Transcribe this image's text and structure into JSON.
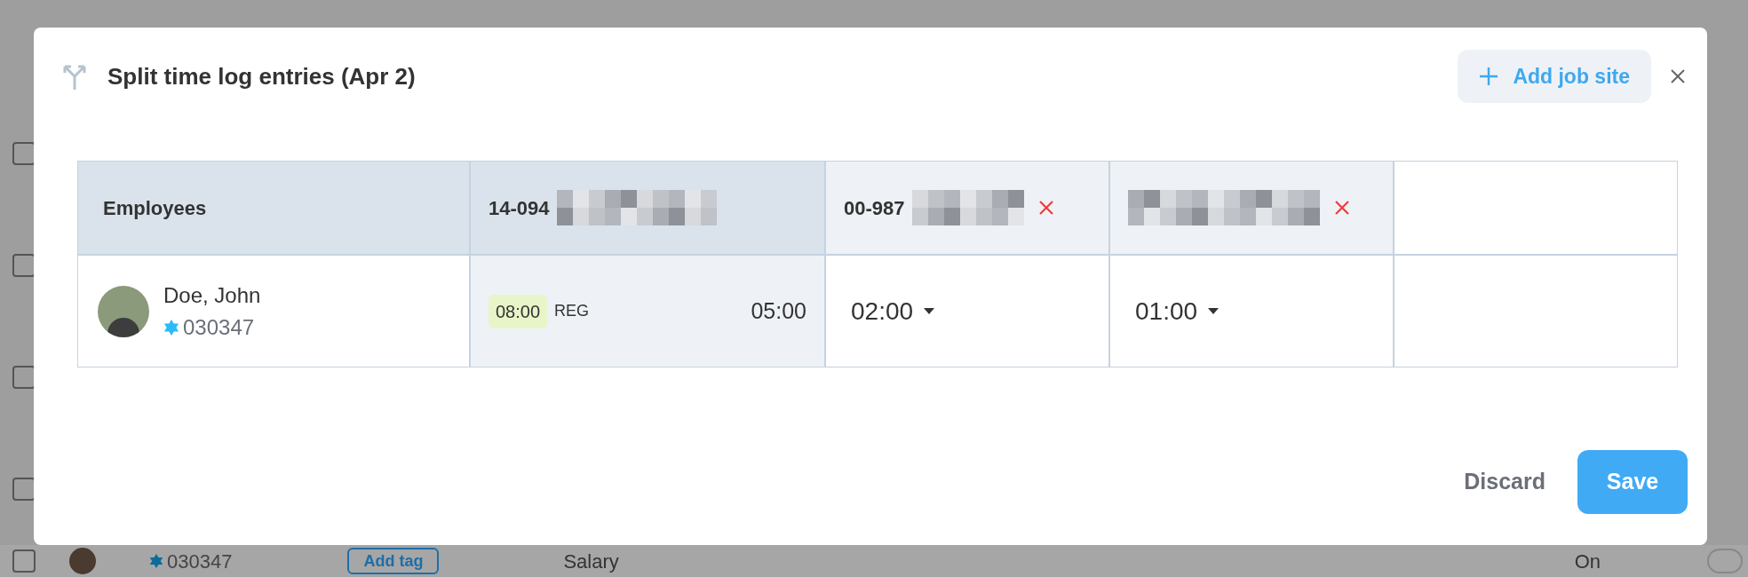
{
  "background": {
    "checkboxes": [
      {
        "checked": false
      },
      {
        "checked": false
      },
      {
        "checked": false
      },
      {
        "checked": false
      },
      {
        "checked": false
      }
    ],
    "employee_id": "030347",
    "tag_button": "Add tag",
    "pay_type": "Salary",
    "status": "On"
  },
  "dialog": {
    "title": "Split time log entries (Apr 2)",
    "add_button": "Add job site",
    "columns": [
      {
        "kind": "employees",
        "label": "Employees"
      },
      {
        "kind": "site",
        "code": "14-094",
        "highlighted": true,
        "removable": false
      },
      {
        "kind": "site",
        "code": "00-987",
        "highlighted": false,
        "removable": true
      },
      {
        "kind": "site",
        "highlighted": false,
        "removable": true
      },
      {
        "kind": "empty"
      }
    ],
    "rows": [
      {
        "cells": [
          {
            "kind": "employee",
            "name": "Doe, John",
            "employee_id": "030347"
          },
          {
            "kind": "hours",
            "badge": "08:00",
            "type": "REG",
            "total": "05:00"
          },
          {
            "kind": "select",
            "value": "02:00"
          },
          {
            "kind": "select",
            "value": "01:00"
          },
          {
            "kind": "empty"
          }
        ]
      }
    ],
    "discard": "Discard",
    "save": "Save"
  }
}
